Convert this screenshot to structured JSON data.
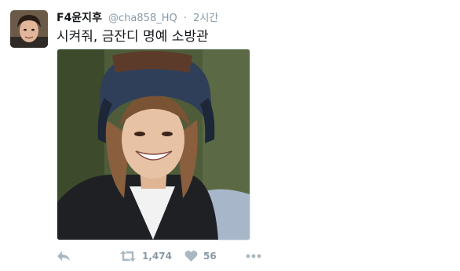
{
  "tweet": {
    "display_name": "F4윤지후",
    "handle": "@cha858_HQ",
    "separator": "·",
    "time": "2시간",
    "text": "시켜줘, 금잔디 명예 소방관",
    "actions": {
      "reply_icon": "reply-icon",
      "retweet_icon": "retweet-icon",
      "retweet_count": "1,474",
      "like_icon": "heart-icon",
      "like_count": "56",
      "more_icon": "more-dots-icon"
    }
  },
  "colors": {
    "text": "#14171a",
    "muted": "#8899a6",
    "icon": "#aab8c2",
    "border": "#e1e8ed"
  }
}
